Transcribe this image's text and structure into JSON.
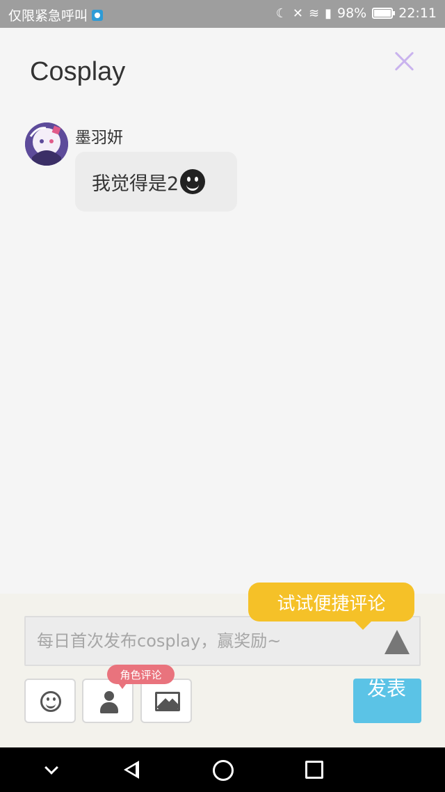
{
  "status_bar": {
    "carrier": "仅限紧急呼叫",
    "battery_percent": "98%",
    "battery_level": 0.98,
    "time": "22:11",
    "icons": [
      "app-notification-icon",
      "moon-icon",
      "mute-icon",
      "wifi-icon",
      "signal-icon",
      "battery-icon"
    ]
  },
  "header": {
    "title": "Cosplay",
    "close_icon": "close-icon",
    "close_color": "#c9b3ee"
  },
  "comments": [
    {
      "user": "墨羽妍",
      "text": "我觉得是2",
      "emoji": "smiley-emoji-icon"
    }
  ],
  "composer": {
    "tooltip": "试试便捷评论",
    "placeholder": "每日首次发布cosplay，赢奖励~",
    "role_badge": "角色评论",
    "publish_label": "发表",
    "tools": [
      "emoji-icon",
      "person-icon",
      "image-icon"
    ],
    "colors": {
      "tooltip": "#f5c128",
      "badge": "#e9737d",
      "publish": "#5bc3e6"
    }
  },
  "nav_bar": {
    "buttons": [
      "chevron-down-icon",
      "back-icon",
      "home-icon",
      "recent-apps-icon"
    ]
  }
}
